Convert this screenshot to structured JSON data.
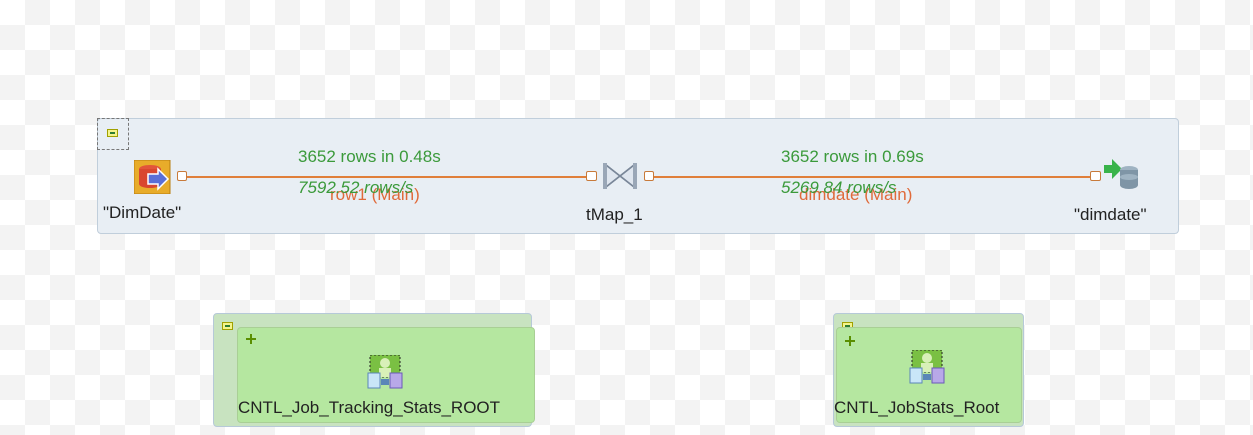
{
  "job": {
    "components": {
      "input": {
        "label": "\"DimDate\"",
        "icon": "db-input-icon"
      },
      "map": {
        "label": "tMap_1",
        "icon": "tmap-icon"
      },
      "output": {
        "label": "\"dimdate\"",
        "icon": "db-output-icon"
      }
    },
    "connections": [
      {
        "name": "row1 (Main)",
        "stats": "3652 rows in 0.48s",
        "rate": "7592.52 rows/s"
      },
      {
        "name": "dimdate (Main)",
        "stats": "3652 rows in 0.69s",
        "rate": "5269.84 rows/s"
      }
    ]
  },
  "trackers": [
    {
      "label": "CNTL_Job_Tracking_Stats_ROOT",
      "icon": "job-tracker-icon"
    },
    {
      "label": "CNTL_JobStats_Root",
      "icon": "job-tracker-icon"
    }
  ],
  "colors": {
    "link": "#e07f3a",
    "stats_text": "#3b9a3b",
    "connection_text": "#e06a3a",
    "subjob_bg": "#e8eef4",
    "tracker_bg": "#b5e7a0"
  }
}
